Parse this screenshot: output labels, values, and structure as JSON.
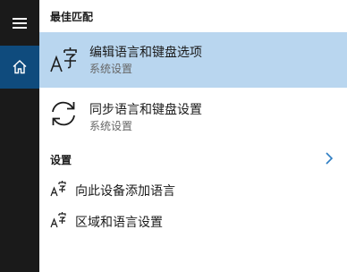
{
  "colors": {
    "rail_background": "#1a1a1a",
    "rail_home_active": "#0f4b7d",
    "selected_row": "#b9d6ef",
    "chevron_accent": "#2d7dc3"
  },
  "rail": {
    "menu_icon": "hamburger-icon",
    "home_icon": "home-icon"
  },
  "best_match": {
    "header": "最佳匹配",
    "items": [
      {
        "title": "编辑语言和键盘选项",
        "subtitle": "系统设置",
        "icon": "language-icon"
      },
      {
        "title": "同步语言和键盘设置",
        "subtitle": "系统设置",
        "icon": "sync-icon"
      }
    ]
  },
  "settings": {
    "header": "设置",
    "expand_icon": "chevron-right-icon",
    "items": [
      {
        "label": "向此设备添加语言",
        "icon": "language-small-icon"
      },
      {
        "label": "区域和语言设置",
        "icon": "language-small-icon"
      }
    ]
  }
}
